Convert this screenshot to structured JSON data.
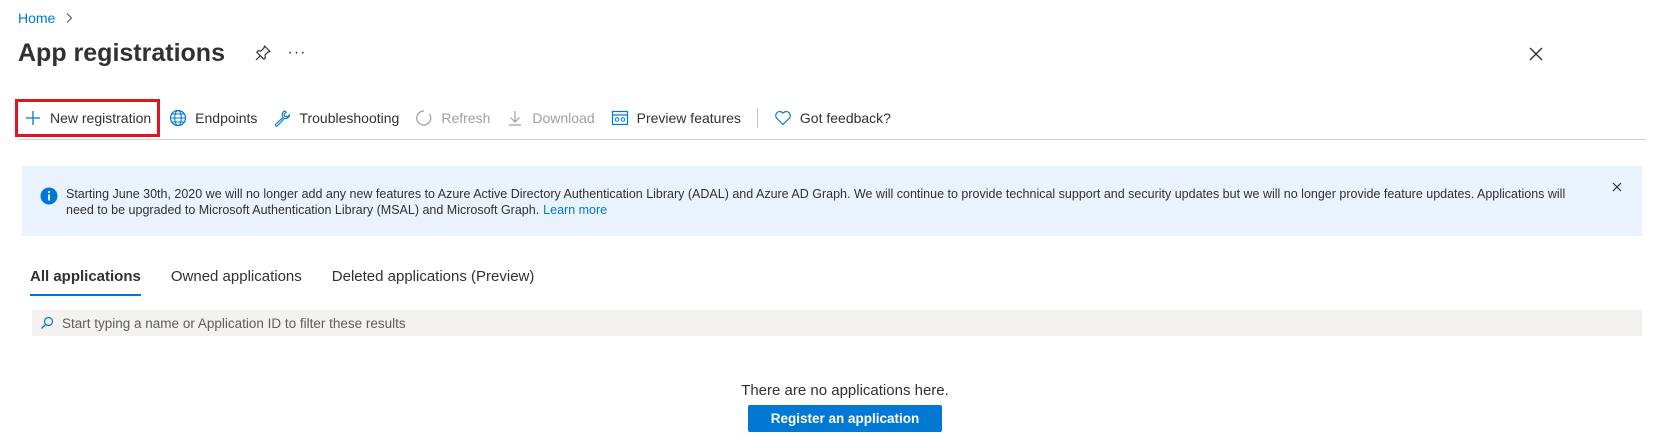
{
  "breadcrumb": {
    "home": "Home"
  },
  "header": {
    "title": "App registrations",
    "more": "···"
  },
  "toolbar": {
    "new_registration": "New registration",
    "endpoints": "Endpoints",
    "troubleshooting": "Troubleshooting",
    "refresh": "Refresh",
    "download": "Download",
    "preview_features": "Preview features",
    "feedback": "Got feedback?"
  },
  "banner": {
    "text": "Starting June 30th, 2020 we will no longer add any new features to Azure Active Directory Authentication Library (ADAL) and Azure AD Graph. We will continue to provide technical support and security updates but we will no longer provide feature updates. Applications will need to be upgraded to Microsoft Authentication Library (MSAL) and Microsoft Graph.",
    "link": "Learn more"
  },
  "tabs": [
    {
      "label": "All applications",
      "active": true
    },
    {
      "label": "Owned applications",
      "active": false
    },
    {
      "label": "Deleted applications (Preview)",
      "active": false
    }
  ],
  "filter": {
    "placeholder": "Start typing a name or Application ID to filter these results",
    "value": ""
  },
  "empty_state": {
    "message": "There are no applications here.",
    "button": "Register an application"
  },
  "colors": {
    "accent": "#0078d4",
    "highlight": "#e0151f",
    "banner_bg": "#eaf3fd",
    "disabled": "#a19f9d"
  },
  "icons": [
    "chevron-right-icon",
    "pin-icon",
    "more-icon",
    "close-icon",
    "plus-icon",
    "globe-icon",
    "wrench-icon",
    "refresh-icon",
    "download-icon",
    "preview-icon",
    "heart-icon",
    "info-icon",
    "search-icon"
  ]
}
